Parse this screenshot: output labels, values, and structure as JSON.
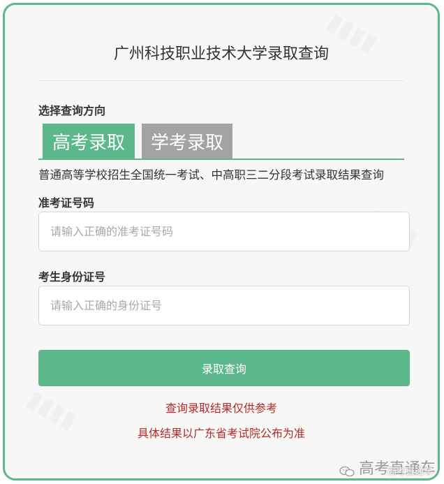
{
  "page": {
    "title": "广州科技职业技术大学录取查询",
    "direction_label": "选择查询方向",
    "tabs": [
      {
        "label": "高考录取",
        "active": true
      },
      {
        "label": "学考录取",
        "active": false
      }
    ],
    "tab_description": "普通高等学校招生全国统一考试、中高职三二分段考试录取结果查询",
    "exam_id": {
      "label": "准考证号码",
      "placeholder": "请输入正确的准考证号码",
      "value": ""
    },
    "id_card": {
      "label": "考生身份证号",
      "placeholder": "请输入正确的身份证号",
      "value": ""
    },
    "submit_label": "录取查询",
    "notes": [
      "查询录取结果仅供参考",
      "具体结果以广东省考试院公布为准"
    ]
  },
  "brand": {
    "name": "高考直通车",
    "subtitle": "高考直通车",
    "icon": "wechat-icon"
  },
  "colors": {
    "accent": "#5cb88a",
    "tab_inactive": "#a3a3a3",
    "note_red": "#b22a2a"
  }
}
